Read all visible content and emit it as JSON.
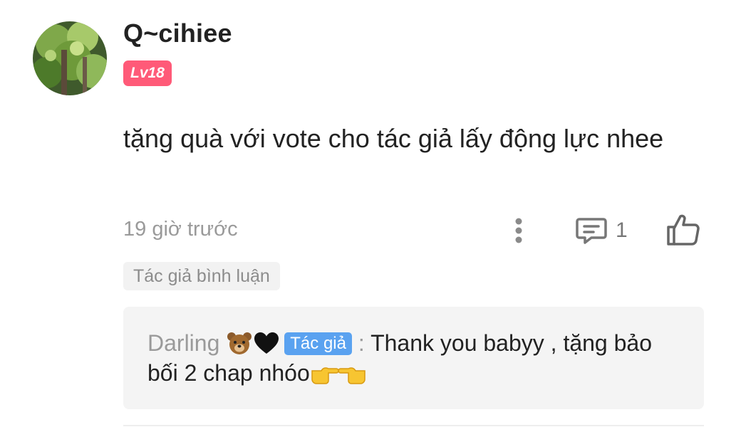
{
  "comment": {
    "username": "Q~cihiee",
    "level": "Lv18",
    "text": "tặng quà với vote cho tác giả lấy động lực nhee",
    "timestamp": "19 giờ trước",
    "reply_count": "1",
    "author_tag": "Tác giả bình luận",
    "icons": {
      "more": "more-vertical-icon",
      "reply": "comment-bubble-icon",
      "like": "thumbs-up-icon"
    }
  },
  "reply": {
    "name": "Darling",
    "author_badge": "Tác giả",
    "separator": ":",
    "text": "Thank you babyy , tặng bảo bối 2 chap nhóo",
    "emojis": [
      "bear-emoji",
      "black-heart-emoji",
      "pointing-right-emoji",
      "pointing-left-emoji"
    ]
  },
  "colors": {
    "level_badge": "#ff5a78",
    "author_badge": "#5aa2f0",
    "muted_text": "#9a9a9a",
    "reply_background": "#f4f4f4"
  }
}
